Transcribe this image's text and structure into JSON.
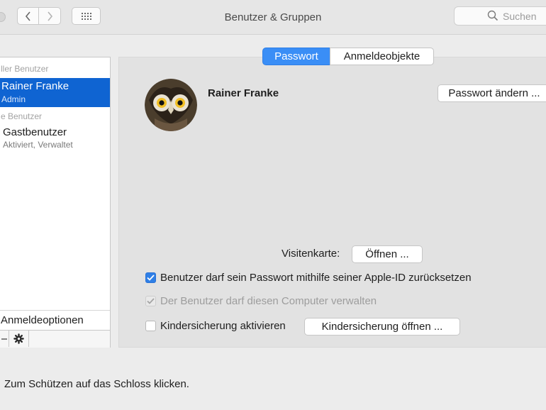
{
  "window": {
    "title": "Benutzer & Gruppen"
  },
  "toolbar": {
    "back_icon": "chevron-left",
    "forward_icon": "chevron-right",
    "grid_icon": "grid-dots",
    "search_placeholder": "Suchen"
  },
  "sidebar": {
    "group_current": "ller Benutzer",
    "current_user": {
      "name": "Rainer Franke",
      "role": "Admin"
    },
    "group_other": "e Benutzer",
    "guest_user": {
      "name": "Gastbenutzer",
      "status": "Aktiviert, Verwaltet"
    },
    "login_options": "Anmeldeoptionen"
  },
  "tabs": {
    "active": "Passwort",
    "inactive": "Anmeldeobjekte"
  },
  "main": {
    "user_name": "Rainer Franke",
    "change_password_button": "Passwort ändern ...",
    "contact_card_label": "Visitenkarte:",
    "contact_card_button": "Öffnen ...",
    "checkbox_reset": {
      "label": "Benutzer darf sein Passwort mithilfe seiner Apple-ID zurücksetzen",
      "checked": true
    },
    "checkbox_admin": {
      "label": "Der Benutzer darf diesen Computer verwalten",
      "checked": true,
      "disabled": true
    },
    "checkbox_parental": {
      "label": "Kindersicherung aktivieren",
      "checked": false
    },
    "parental_button": "Kindersicherung öffnen ..."
  },
  "footer": {
    "lock_text": "Zum Schützen auf das Schloss klicken."
  },
  "colors": {
    "accent": "#0f64d2",
    "segment_active": "#3a8ef6",
    "window_bg": "#ececec",
    "panel_bg": "#e2e2e2"
  }
}
